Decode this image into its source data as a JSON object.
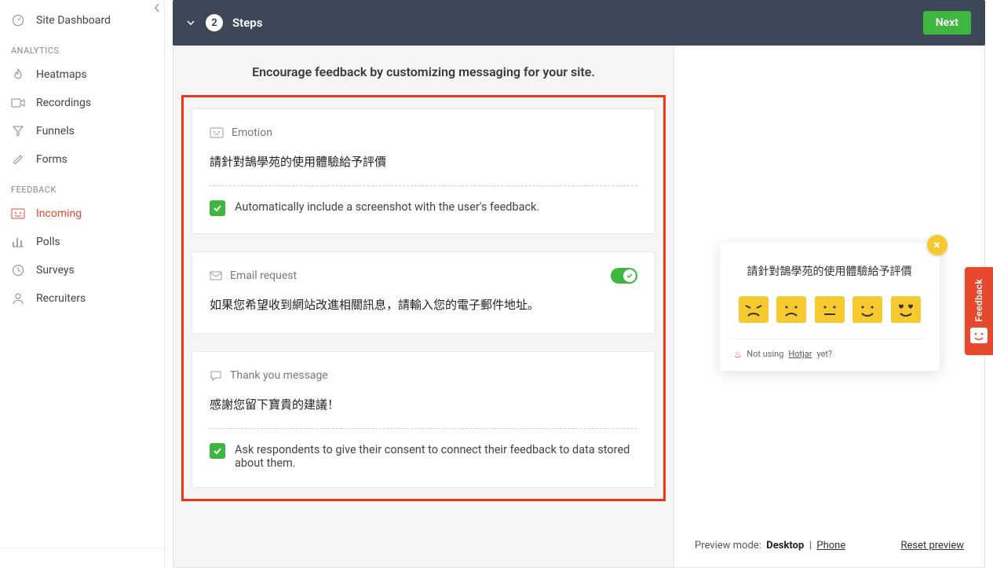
{
  "sidebar": {
    "dashboard": "Site Dashboard",
    "sections": {
      "analytics": "ANALYTICS",
      "feedback": "FEEDBACK"
    },
    "items": {
      "heatmaps": "Heatmaps",
      "recordings": "Recordings",
      "funnels": "Funnels",
      "forms": "Forms",
      "incoming": "Incoming",
      "polls": "Polls",
      "surveys": "Surveys",
      "recruiters": "Recruiters"
    }
  },
  "stepbar": {
    "number": "2",
    "title": "Steps",
    "next": "Next"
  },
  "intro": "Encourage feedback by customizing messaging for your site.",
  "cards": {
    "emotion": {
      "label": "Emotion",
      "body": "請針對鵠學苑的使用體驗給予評價",
      "checkbox": "Automatically include a screenshot with the user's feedback."
    },
    "email": {
      "label": "Email request",
      "body": "如果您希望收到網站改進相關訊息，請輸入您的電子郵件地址。"
    },
    "thanks": {
      "label": "Thank you message",
      "body": "感謝您留下寶貴的建議！",
      "checkbox": "Ask respondents to give their consent to connect their feedback to data stored about them."
    }
  },
  "preview": {
    "title": "請針對鵠學苑的使用體驗給予評價",
    "foot_pre": "Not using",
    "foot_link": "Hotjar",
    "foot_post": "yet?",
    "mode_label": "Preview mode:",
    "mode_desktop": "Desktop",
    "mode_phone": "Phone",
    "reset": "Reset preview"
  },
  "feedback_tab": "Feedback"
}
